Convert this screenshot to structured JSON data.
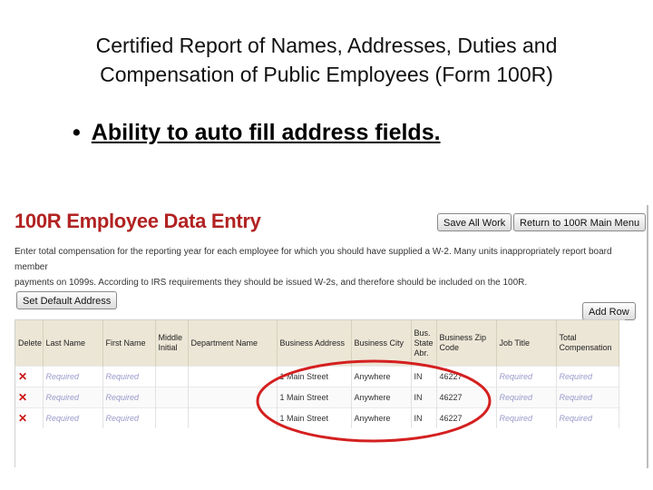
{
  "slide": {
    "title_line1": "Certified Report of Names, Addresses, Duties and",
    "title_line2": "Compensation of Public Employees (Form 100R)",
    "bullet": "Ability to auto fill address fields."
  },
  "app": {
    "title": "100R Employee Data Entry",
    "save_label": "Save All Work",
    "return_label": "Return to 100R Main Menu",
    "instructions_line1": "Enter total compensation for the reporting year for each employee for which you should have supplied a W-2. Many units inappropriately report board member",
    "instructions_line2": "payments on 1099s. According to IRS requirements they should be issued W-2s, and therefore should be included on the 100R.",
    "set_default_label": "Set Default Address",
    "add_row_label": "Add Row"
  },
  "grid": {
    "headers": [
      "Delete",
      "Last Name",
      "First Name",
      "Middle Initial",
      "Department Name",
      "Business Address",
      "Business City",
      "Bus. State Abr.",
      "Business Zip Code",
      "Job Title",
      "Total Compensation"
    ],
    "rows": [
      [
        "Required",
        "Required",
        "",
        "",
        "1 Main Street",
        "Anywhere",
        "IN",
        "46227",
        "Required",
        "Required"
      ],
      [
        "Required",
        "Required",
        "",
        "",
        "1 Main Street",
        "Anywhere",
        "IN",
        "46227",
        "Required",
        "Required"
      ],
      [
        "Required",
        "Required",
        "",
        "",
        "1 Main Street",
        "Anywhere",
        "IN",
        "46227",
        "Required",
        "Required"
      ]
    ]
  },
  "colors": {
    "title_red": "#b22222",
    "delete_red": "#cc1111",
    "header_bg": "#ece6d6",
    "highlight_ellipse": "#d42020"
  }
}
